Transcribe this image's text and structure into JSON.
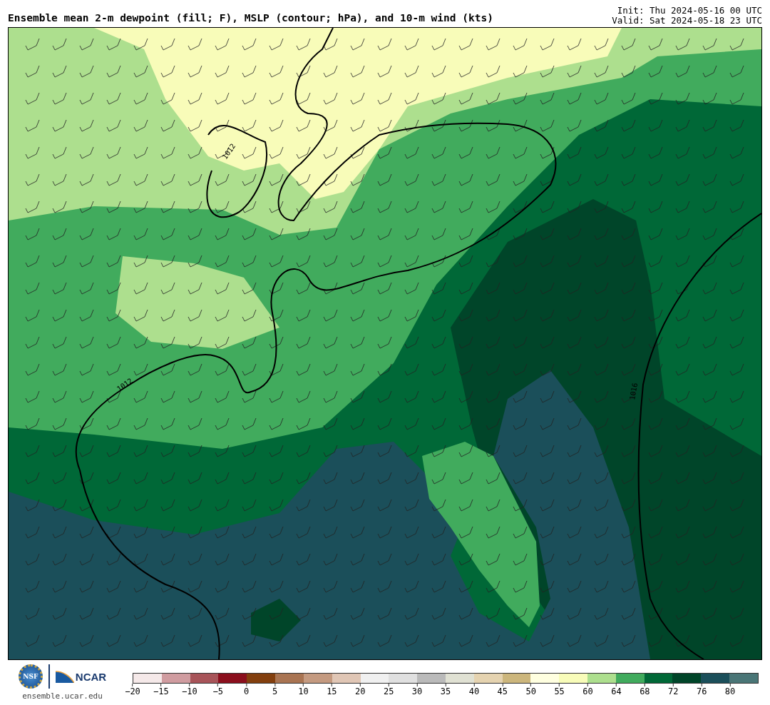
{
  "header": {
    "title": "Ensemble mean 2-m dewpoint (fill; F), MSLP (contour; hPa), and 10-m wind (kts)",
    "init": "Init: Thu 2024-05-16 00 UTC",
    "valid": "Valid: Sat 2024-05-18 23 UTC"
  },
  "map": {
    "isobars": [
      {
        "label": "1012"
      },
      {
        "label": "1012"
      },
      {
        "label": "1016"
      }
    ]
  },
  "footer": {
    "nsf_logo": "NSF",
    "ncar_logo": "NCAR",
    "site": "ensemble.ucar.edu"
  },
  "colorbar": {
    "bins": [
      {
        "label": "−20",
        "color": "#f5e9e9"
      },
      {
        "label": "−15",
        "color": "#d09ca0"
      },
      {
        "label": "−10",
        "color": "#a85459"
      },
      {
        "label": "−5",
        "color": "#8b0f1d"
      },
      {
        "label": "0",
        "color": "#833f0e"
      },
      {
        "label": "5",
        "color": "#a97452"
      },
      {
        "label": "10",
        "color": "#c49a80"
      },
      {
        "label": "15",
        "color": "#e0c6b5"
      },
      {
        "label": "20",
        "color": "#f0f0f0"
      },
      {
        "label": "25",
        "color": "#e0e0e0"
      },
      {
        "label": "30",
        "color": "#bababa"
      },
      {
        "label": "35",
        "color": "#e0e1d3"
      },
      {
        "label": "40",
        "color": "#e5d3b0"
      },
      {
        "label": "45",
        "color": "#ccb67c"
      },
      {
        "label": "50",
        "color": "#ffffe0"
      },
      {
        "label": "55",
        "color": "#f8fcb9"
      },
      {
        "label": "60",
        "color": "#addf8e"
      },
      {
        "label": "64",
        "color": "#41ab5d"
      },
      {
        "label": "68",
        "color": "#006837"
      },
      {
        "label": "72",
        "color": "#004529"
      },
      {
        "label": "76",
        "color": "#1b4f5a"
      },
      {
        "label": "80",
        "color": "#4a7677"
      }
    ]
  }
}
